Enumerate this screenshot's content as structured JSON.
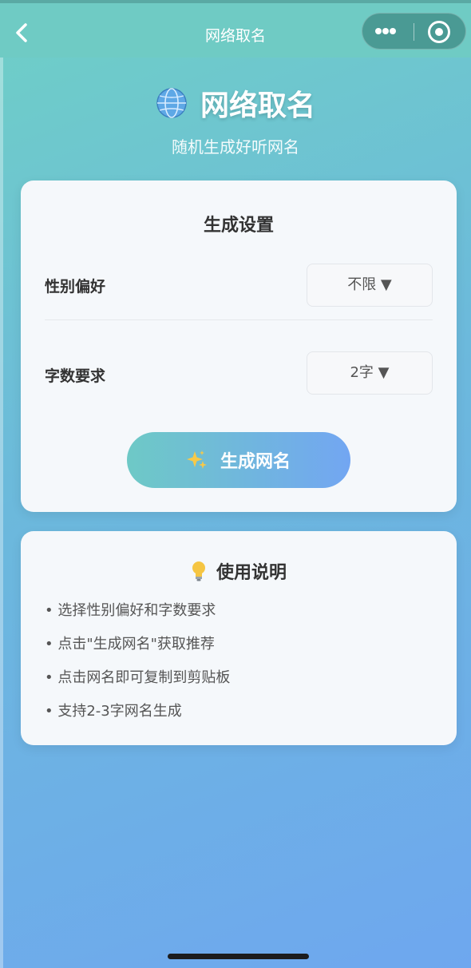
{
  "nav": {
    "title": "网络取名"
  },
  "header": {
    "title": "网络取名",
    "subtitle": "随机生成好听网名",
    "icon": "globe-icon"
  },
  "settings": {
    "title": "生成设置",
    "gender": {
      "label": "性别偏好",
      "value": "不限 ▼"
    },
    "length": {
      "label": "字数要求",
      "value": "2字 ▼"
    },
    "generate_label": "生成网名"
  },
  "help": {
    "title": "使用说明",
    "items": [
      "• 选择性别偏好和字数要求",
      "• 点击\"生成网名\"获取推荐",
      "• 点击网名即可复制到剪贴板",
      "• 支持2-3字网名生成"
    ]
  },
  "colors": {
    "accent_start": "#6ec9c6",
    "accent_end": "#72a6f2",
    "nav_bg": "#6fcbc4"
  }
}
